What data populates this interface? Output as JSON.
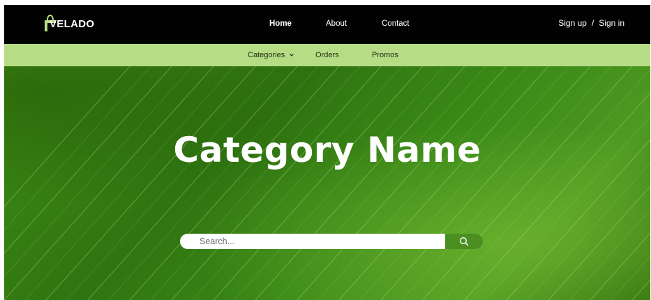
{
  "brand": {
    "name": "VELADO",
    "logo_icon": "shopping-bag-icon",
    "accent_color": "#b6dc86"
  },
  "main_nav": {
    "home": "Home",
    "about": "About",
    "contact": "Contact"
  },
  "auth": {
    "sign_up": "Sign up",
    "separator": "/",
    "sign_in": "Sign in"
  },
  "sub_nav": {
    "categories": "Categories",
    "categories_icon": "chevron-down-icon",
    "orders": "Orders",
    "promos": "Promos"
  },
  "hero": {
    "title": "Category Name",
    "background": "green-leaf-texture"
  },
  "search": {
    "placeholder": "Search...",
    "icon": "search-icon",
    "button_color": "#4b8f23"
  }
}
